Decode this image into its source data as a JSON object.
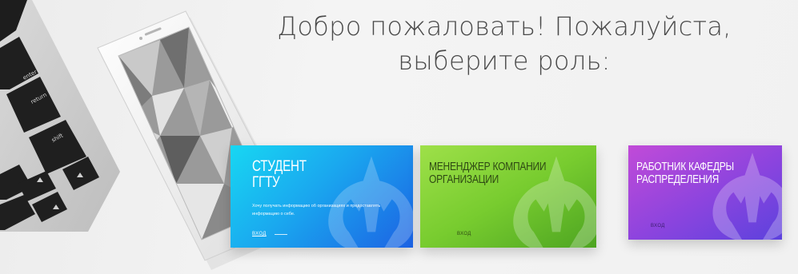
{
  "heading": {
    "line1": "Добро пожаловать! Пожалуйста,",
    "line2": "выберите роль:"
  },
  "keyboard_keys": [
    "enter",
    "return",
    "shift"
  ],
  "roles": [
    {
      "title_line1": "СТУДЕНТ",
      "title_line2": "ГГТУ",
      "description": "Хочу получать информацию об организациях и предоставлять информацию о себе.",
      "login_label": "ВХОД"
    },
    {
      "title_line1": "МЕНЕНДЖЕР КОМПАНИИ",
      "title_line2": "ОРГАНИЗАЦИИ",
      "login_label": "ВХОД"
    },
    {
      "title_line1": "РАБОТНИК КАФЕДРЫ",
      "title_line2": "РАСПРЕДЕЛЕНИЯ",
      "login_label": "ВХОД"
    }
  ],
  "colors": {
    "student": "#1aa7ef",
    "manager": "#78cc2f",
    "dept": "#8b44de",
    "heading_text": "#4a4a4a"
  },
  "icons": [
    "keyboard-photo",
    "phone-photo",
    "rebel-alliance-emblem-icon"
  ]
}
